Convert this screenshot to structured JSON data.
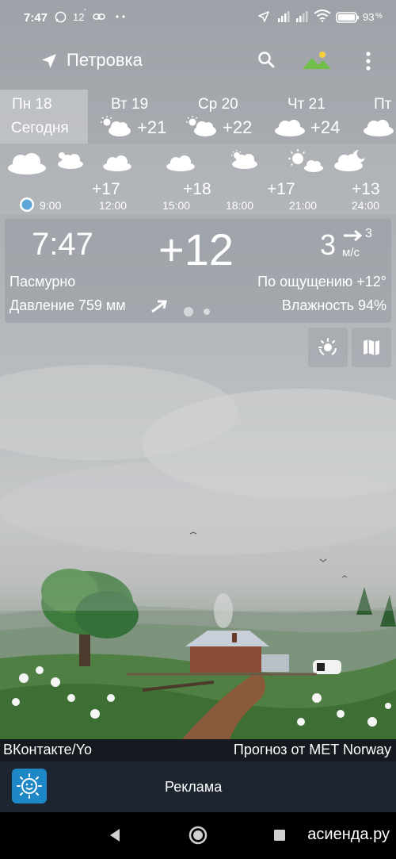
{
  "status_bar": {
    "time": "7:47",
    "temp": "12",
    "battery": "93",
    "icons": [
      "whatsapp-icon",
      "link-icon",
      "more-dots-icon",
      "location-arrow-icon",
      "signal-icon",
      "wifi-icon",
      "battery-icon"
    ]
  },
  "header": {
    "city": "Петровка",
    "icons": [
      "location-arrow-icon",
      "search-icon",
      "landscape-icon",
      "more-vert-icon"
    ]
  },
  "days": [
    {
      "name": "Пн 18",
      "sub": "Сегодня",
      "active": true
    },
    {
      "name": "Вт 19",
      "temp": "+21",
      "icon": "partly-cloudy-icon"
    },
    {
      "name": "Ср 20",
      "temp": "+22",
      "icon": "partly-cloudy-icon"
    },
    {
      "name": "Чт 21",
      "temp": "+24",
      "icon": "cloud-icon"
    },
    {
      "name": "Пт",
      "icon": "cloud-icon"
    }
  ],
  "hourly": [
    {
      "time": "9:00",
      "temp": "",
      "icon": "cloud-icon"
    },
    {
      "time": "12:00",
      "temp": "+17",
      "icon": "cloud-icon"
    },
    {
      "time": "15:00",
      "temp": "+18",
      "icon": "cloud-icon"
    },
    {
      "time": "18:00",
      "temp": "+17",
      "icon": "partly-cloudy-icon"
    },
    {
      "time": "21:00",
      "temp": "",
      "icon": "sun-cloud-icon"
    },
    {
      "time": "24:00",
      "temp": "+13",
      "icon": "night-cloud-icon"
    }
  ],
  "current": {
    "time": "7:47",
    "temp": "+12",
    "wind_speed": "3",
    "wind_gust": "3",
    "wind_unit": "м/с",
    "condition": "Пасмурно",
    "feels_like": "По ощущению +12°",
    "pressure": "Давление 759 мм",
    "humidity": "Влажность 94%",
    "page": 1,
    "pages": 2
  },
  "side_buttons": [
    "sun-rays-icon",
    "map-icon"
  ],
  "footer": {
    "left": "ВКонтакте/Yo",
    "right": "Прогноз от MET Norway"
  },
  "ad": {
    "label": "Реклама"
  },
  "watermark": "асиенда.ру",
  "nav": [
    "back-icon",
    "home-icon",
    "recents-icon"
  ]
}
